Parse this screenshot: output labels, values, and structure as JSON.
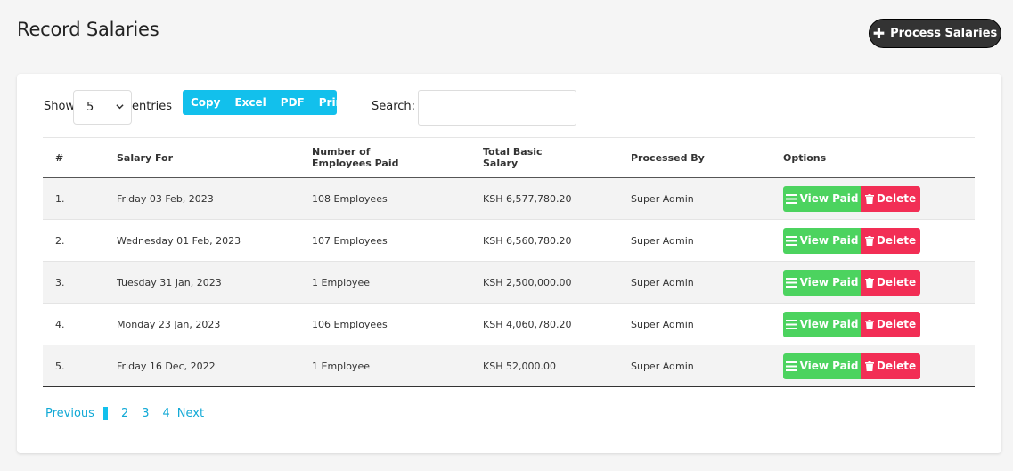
{
  "page": {
    "title": "Record Salaries",
    "process_button_label": "Process Salaries"
  },
  "controls": {
    "show_label": "Show",
    "entries_value": "5",
    "entries_label": "entries",
    "export_buttons": [
      "Copy",
      "Excel",
      "PDF",
      "Print"
    ],
    "search_label": "Search:",
    "search_value": ""
  },
  "table": {
    "headers": {
      "num": "#",
      "salary_for": "Salary For",
      "employees_paid_line1": "Number of",
      "employees_paid_line2": "Employees Paid",
      "total_basic_line1": "Total Basic",
      "total_basic_line2": "Salary",
      "processed_by": "Processed By",
      "options": "Options"
    },
    "rows": [
      {
        "num": "1.",
        "salary_for": "Friday 03 Feb, 2023",
        "employees": "108 Employees",
        "total": "KSH 6,577,780.20",
        "processed_by": "Super Admin"
      },
      {
        "num": "2.",
        "salary_for": "Wednesday 01 Feb, 2023",
        "employees": "107 Employees",
        "total": "KSH 6,560,780.20",
        "processed_by": "Super Admin"
      },
      {
        "num": "3.",
        "salary_for": "Tuesday 31 Jan, 2023",
        "employees": "1 Employee",
        "total": "KSH 2,500,000.00",
        "processed_by": "Super Admin"
      },
      {
        "num": "4.",
        "salary_for": "Monday 23 Jan, 2023",
        "employees": "106 Employees",
        "total": "KSH 4,060,780.20",
        "processed_by": "Super Admin"
      },
      {
        "num": "5.",
        "salary_for": "Friday 16 Dec, 2022",
        "employees": "1 Employee",
        "total": "KSH 52,000.00",
        "processed_by": "Super Admin"
      }
    ],
    "view_label": "View Paid",
    "delete_label": "Delete"
  },
  "pagination": {
    "previous": "Previous",
    "pages": [
      "2",
      "3",
      "4"
    ],
    "next": "Next"
  },
  "colors": {
    "accent": "#12c0ec",
    "view": "#4cd35f",
    "delete": "#f22e55",
    "dark_button": "#333333"
  }
}
